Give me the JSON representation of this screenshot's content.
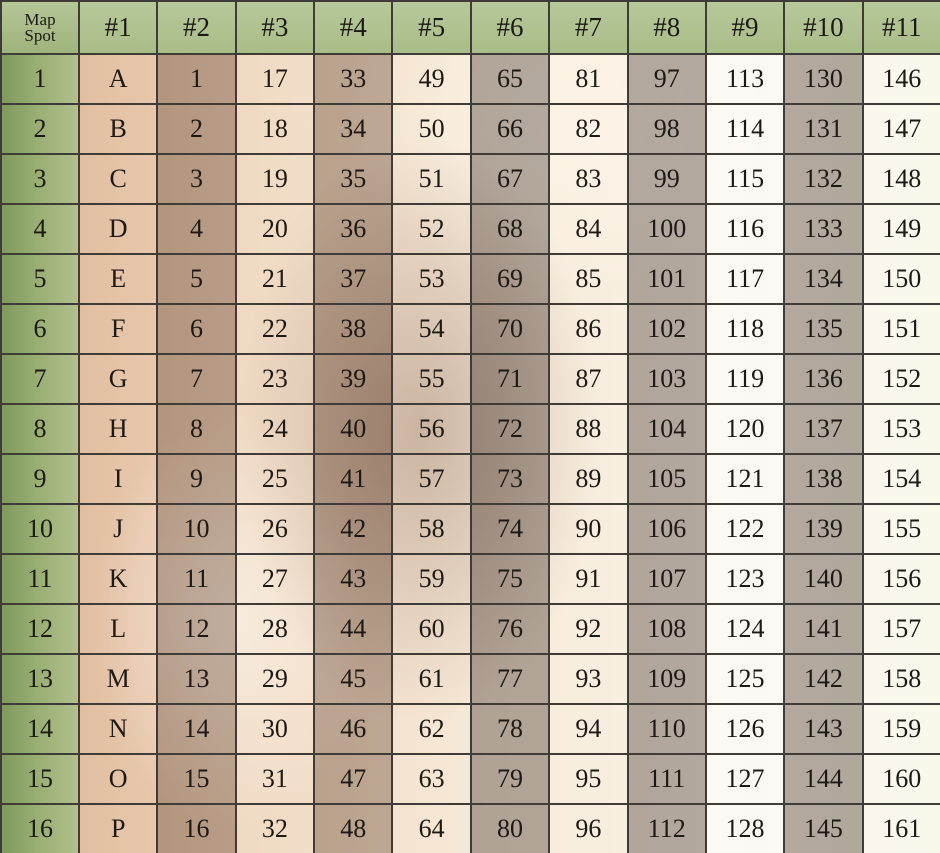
{
  "header": {
    "corner_line1": "Map",
    "corner_line2": "Spot",
    "columns": [
      "#1",
      "#2",
      "#3",
      "#4",
      "#5",
      "#6",
      "#7",
      "#8",
      "#9",
      "#10",
      "#11"
    ]
  },
  "rows": [
    {
      "spot": "1",
      "cells": [
        "A",
        "1",
        "17",
        "33",
        "49",
        "65",
        "81",
        "97",
        "113",
        "130",
        "146"
      ]
    },
    {
      "spot": "2",
      "cells": [
        "B",
        "2",
        "18",
        "34",
        "50",
        "66",
        "82",
        "98",
        "114",
        "131",
        "147"
      ]
    },
    {
      "spot": "3",
      "cells": [
        "C",
        "3",
        "19",
        "35",
        "51",
        "67",
        "83",
        "99",
        "115",
        "132",
        "148"
      ]
    },
    {
      "spot": "4",
      "cells": [
        "D",
        "4",
        "20",
        "36",
        "52",
        "68",
        "84",
        "100",
        "116",
        "133",
        "149"
      ]
    },
    {
      "spot": "5",
      "cells": [
        "E",
        "5",
        "21",
        "37",
        "53",
        "69",
        "85",
        "101",
        "117",
        "134",
        "150"
      ]
    },
    {
      "spot": "6",
      "cells": [
        "F",
        "6",
        "22",
        "38",
        "54",
        "70",
        "86",
        "102",
        "118",
        "135",
        "151"
      ]
    },
    {
      "spot": "7",
      "cells": [
        "G",
        "7",
        "23",
        "39",
        "55",
        "71",
        "87",
        "103",
        "119",
        "136",
        "152"
      ]
    },
    {
      "spot": "8",
      "cells": [
        "H",
        "8",
        "24",
        "40",
        "56",
        "72",
        "88",
        "104",
        "120",
        "137",
        "153"
      ]
    },
    {
      "spot": "9",
      "cells": [
        "I",
        "9",
        "25",
        "41",
        "57",
        "73",
        "89",
        "105",
        "121",
        "138",
        "154"
      ]
    },
    {
      "spot": "10",
      "cells": [
        "J",
        "10",
        "26",
        "42",
        "58",
        "74",
        "90",
        "106",
        "122",
        "139",
        "155"
      ]
    },
    {
      "spot": "11",
      "cells": [
        "K",
        "11",
        "27",
        "43",
        "59",
        "75",
        "91",
        "107",
        "123",
        "140",
        "156"
      ]
    },
    {
      "spot": "12",
      "cells": [
        "L",
        "12",
        "28",
        "44",
        "60",
        "76",
        "92",
        "108",
        "124",
        "141",
        "157"
      ]
    },
    {
      "spot": "13",
      "cells": [
        "M",
        "13",
        "29",
        "45",
        "61",
        "77",
        "93",
        "109",
        "125",
        "142",
        "158"
      ]
    },
    {
      "spot": "14",
      "cells": [
        "N",
        "14",
        "30",
        "46",
        "62",
        "78",
        "94",
        "110",
        "126",
        "143",
        "159"
      ]
    },
    {
      "spot": "15",
      "cells": [
        "O",
        "15",
        "31",
        "47",
        "63",
        "79",
        "95",
        "111",
        "127",
        "144",
        "160"
      ]
    },
    {
      "spot": "16",
      "cells": [
        "P",
        "16",
        "32",
        "48",
        "64",
        "80",
        "96",
        "112",
        "128",
        "145",
        "161"
      ]
    }
  ],
  "colors": {
    "header_green": "#a9bd88",
    "spot_green": "#8ea868",
    "grid_line": "#3f3b36",
    "text": "#1d1915"
  }
}
